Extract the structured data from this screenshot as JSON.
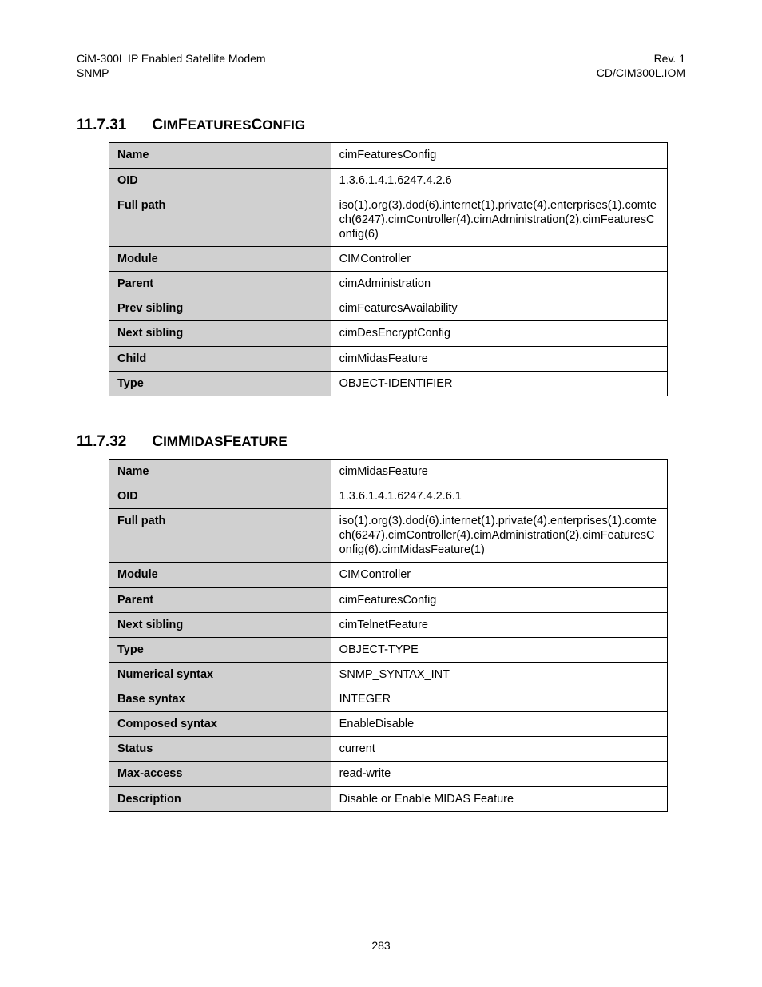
{
  "header": {
    "left_line1": "CiM-300L IP Enabled Satellite Modem",
    "left_line2": "SNMP",
    "right_line1": "Rev. 1",
    "right_line2": "CD/CIM300L.IOM"
  },
  "sections": [
    {
      "num": "11.7.31",
      "title_parts": [
        "C",
        "IM",
        "F",
        "EATURES",
        "C",
        "ONFIG"
      ],
      "rows": [
        {
          "label": "Name",
          "value": "cimFeaturesConfig"
        },
        {
          "label": "OID",
          "value": "1.3.6.1.4.1.6247.4.2.6"
        },
        {
          "label": "Full path",
          "value": "iso(1).org(3).dod(6).internet(1).private(4).enterprises(1).comtech(6247).cimController(4).cimAdministration(2).cimFeaturesConfig(6)"
        },
        {
          "label": "Module",
          "value": "CIMController"
        },
        {
          "label": "Parent",
          "value": "cimAdministration"
        },
        {
          "label": "Prev sibling",
          "value": "cimFeaturesAvailability"
        },
        {
          "label": "Next sibling",
          "value": "cimDesEncryptConfig"
        },
        {
          "label": "Child",
          "value": "cimMidasFeature"
        },
        {
          "label": "Type",
          "value": "OBJECT-IDENTIFIER"
        }
      ]
    },
    {
      "num": "11.7.32",
      "title_parts": [
        "C",
        "IM",
        "M",
        "IDAS",
        "F",
        "EATURE"
      ],
      "rows": [
        {
          "label": "Name",
          "value": "cimMidasFeature"
        },
        {
          "label": "OID",
          "value": "1.3.6.1.4.1.6247.4.2.6.1"
        },
        {
          "label": "Full path",
          "value": "iso(1).org(3).dod(6).internet(1).private(4).enterprises(1).comtech(6247).cimController(4).cimAdministration(2).cimFeaturesConfig(6).cimMidasFeature(1)"
        },
        {
          "label": "Module",
          "value": "CIMController"
        },
        {
          "label": "Parent",
          "value": "cimFeaturesConfig"
        },
        {
          "label": "Next sibling",
          "value": "cimTelnetFeature"
        },
        {
          "label": "Type",
          "value": "OBJECT-TYPE"
        },
        {
          "label": "Numerical syntax",
          "value": "SNMP_SYNTAX_INT"
        },
        {
          "label": "Base syntax",
          "value": "INTEGER"
        },
        {
          "label": "Composed syntax",
          "value": "EnableDisable"
        },
        {
          "label": "Status",
          "value": "current"
        },
        {
          "label": "Max-access",
          "value": "read-write"
        },
        {
          "label": "Description",
          "value": "Disable or Enable MIDAS Feature"
        }
      ]
    }
  ],
  "page_number": "283"
}
